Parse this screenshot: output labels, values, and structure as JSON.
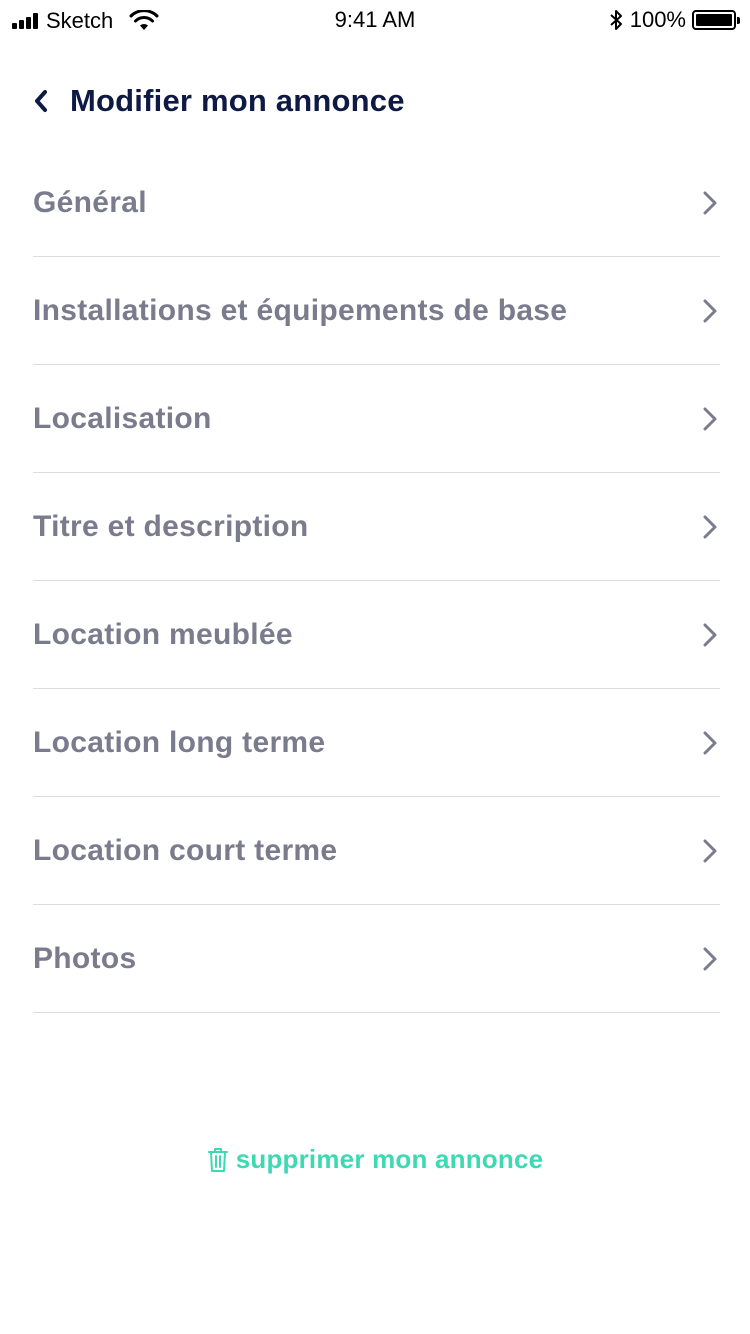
{
  "status_bar": {
    "carrier": "Sketch",
    "time": "9:41 AM",
    "battery": "100%",
    "icons": [
      "signal-icon",
      "wifi-icon",
      "bluetooth-icon",
      "battery-icon"
    ]
  },
  "header": {
    "back_icon": "chevron-left-icon",
    "title": "Modifier mon annonce"
  },
  "menu": {
    "items": [
      {
        "label": "Général"
      },
      {
        "label": "Installations et équipements de base"
      },
      {
        "label": "Localisation"
      },
      {
        "label": "Titre et description"
      },
      {
        "label": "Location meublée"
      },
      {
        "label": "Location long terme"
      },
      {
        "label": "Location court terme"
      },
      {
        "label": "Photos"
      }
    ],
    "item_icon": "chevron-right-icon"
  },
  "delete": {
    "icon": "trash-icon",
    "label": "supprimer mon annonce"
  },
  "colors": {
    "title": "#0f1a44",
    "menu_text": "#7a7b8c",
    "divider": "#dcdde2",
    "accent": "#3dd9b3"
  }
}
